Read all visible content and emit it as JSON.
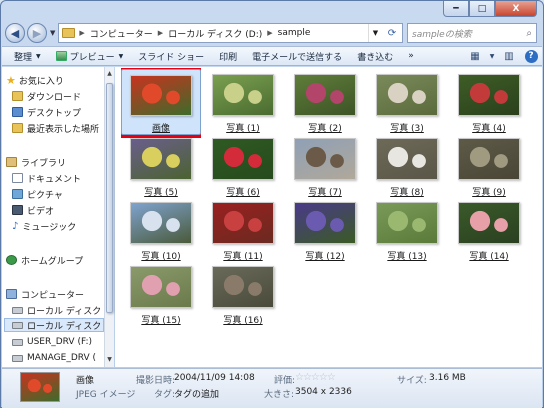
{
  "window": {
    "controls": {
      "minimize": "━",
      "maximize": "□",
      "close": "X"
    }
  },
  "address": {
    "crumbs": [
      "コンピューター",
      "ローカル ディスク (D:)",
      "sample"
    ],
    "search_placeholder": "sampleの検索"
  },
  "toolbar": {
    "organize": "整理",
    "preview": "プレビュー",
    "slideshow": "スライド ショー",
    "print": "印刷",
    "email": "電子メールで送信する",
    "burn": "書き込む",
    "more": "»"
  },
  "nav": {
    "favorites": "お気に入り",
    "downloads": "ダウンロード",
    "desktop": "デスクトップ",
    "recent": "最近表示した場所",
    "libraries": "ライブラリ",
    "documents": "ドキュメント",
    "pictures": "ピクチャ",
    "videos": "ビデオ",
    "music": "ミュージック",
    "homegroup": "ホームグループ",
    "computer": "コンピューター",
    "local1": "ローカル ディスク",
    "local2": "ローカル ディスク",
    "userdrv": "USER_DRV (F:)",
    "managedrv": "MANAGE_DRV ("
  },
  "files": [
    {
      "label": "画像",
      "colors": [
        "#c8331f",
        "#e04a2a",
        "#3e6b2a"
      ]
    },
    {
      "label": "写真 (1)",
      "colors": [
        "#7aa050",
        "#c9d08a",
        "#4a6b30"
      ]
    },
    {
      "label": "写真 (2)",
      "colors": [
        "#5f7d3a",
        "#b3446a",
        "#3d5426"
      ]
    },
    {
      "label": "写真 (3)",
      "colors": [
        "#7b8a5a",
        "#d9d2c2",
        "#5a6a3a"
      ]
    },
    {
      "label": "写真 (4)",
      "colors": [
        "#3e5d26",
        "#c23a3a",
        "#2a401c"
      ]
    },
    {
      "label": "写真 (5)",
      "colors": [
        "#6a5e8c",
        "#d8cf5e",
        "#4b6330"
      ]
    },
    {
      "label": "写真 (6)",
      "colors": [
        "#2f5a23",
        "#d42b3a",
        "#264a1d"
      ]
    },
    {
      "label": "写真 (7)",
      "colors": [
        "#8fa0b6",
        "#6b5a48",
        "#b0a89a"
      ]
    },
    {
      "label": "写真 (8)",
      "colors": [
        "#6e6a58",
        "#e8e6e0",
        "#5a5648"
      ]
    },
    {
      "label": "写真 (9)",
      "colors": [
        "#5e5a48",
        "#a09a80",
        "#4a4636"
      ]
    },
    {
      "label": "写真 (10)",
      "colors": [
        "#7fa3cf",
        "#d8e2ee",
        "#4a5a3a"
      ]
    },
    {
      "label": "写真 (11)",
      "colors": [
        "#9a2020",
        "#c84040",
        "#6a2a20"
      ]
    },
    {
      "label": "写真 (12)",
      "colors": [
        "#4a3a8a",
        "#6a5ab0",
        "#3a5a24"
      ]
    },
    {
      "label": "写真 (13)",
      "colors": [
        "#7a9a5a",
        "#9ab870",
        "#5a7a3a"
      ]
    },
    {
      "label": "写真 (14)",
      "colors": [
        "#3a5a2a",
        "#e8a0a8",
        "#2a4020"
      ]
    },
    {
      "label": "写真 (15)",
      "colors": [
        "#8a9a6a",
        "#e0a0b0",
        "#6a7a4a"
      ]
    },
    {
      "label": "写真 (16)",
      "colors": [
        "#6a6a5a",
        "#8a7a6a",
        "#4a4a3a"
      ]
    }
  ],
  "details": {
    "name": "画像",
    "type": "JPEG イメージ",
    "date_key": "撮影日時:",
    "date_val": "2004/11/09 14:08",
    "tags_key": "タグ:",
    "tags_val": "タグの追加",
    "rating_key": "評価:",
    "rating_stars": "☆☆☆☆☆",
    "size_key": "大きさ:",
    "size_val": "3504 x 2336",
    "filesize_key": "サイズ:",
    "filesize_val": "3.16 MB"
  }
}
